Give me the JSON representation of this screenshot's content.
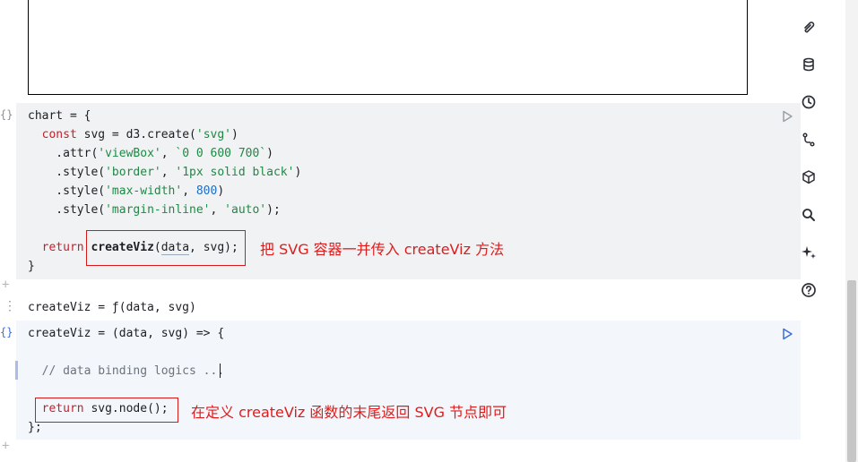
{
  "code_cell_1": {
    "lines": [
      {
        "p": [
          [
            "def",
            "chart"
          ],
          [
            "plain",
            " = {"
          ]
        ]
      },
      {
        "p": [
          [
            "plain",
            "  "
          ],
          [
            "kw",
            "const"
          ],
          [
            "plain",
            " svg = d3."
          ],
          [
            "def",
            "create"
          ],
          [
            "plain",
            "("
          ],
          [
            "str",
            "'svg'"
          ],
          [
            "plain",
            ")"
          ]
        ]
      },
      {
        "p": [
          [
            "plain",
            "    ."
          ],
          [
            "def",
            "attr"
          ],
          [
            "plain",
            "("
          ],
          [
            "str",
            "'viewBox'"
          ],
          [
            "plain",
            ", "
          ],
          [
            "str",
            "`0 0 600 700`"
          ],
          [
            "plain",
            ")"
          ]
        ]
      },
      {
        "p": [
          [
            "plain",
            "    ."
          ],
          [
            "def",
            "style"
          ],
          [
            "plain",
            "("
          ],
          [
            "str",
            "'border'"
          ],
          [
            "plain",
            ", "
          ],
          [
            "str",
            "'1px solid black'"
          ],
          [
            "plain",
            ")"
          ]
        ]
      },
      {
        "p": [
          [
            "plain",
            "    ."
          ],
          [
            "def",
            "style"
          ],
          [
            "plain",
            "("
          ],
          [
            "str",
            "'max-width'"
          ],
          [
            "plain",
            ", "
          ],
          [
            "num",
            "800"
          ],
          [
            "plain",
            ")"
          ]
        ]
      },
      {
        "p": [
          [
            "plain",
            "    ."
          ],
          [
            "def",
            "style"
          ],
          [
            "plain",
            "("
          ],
          [
            "str",
            "'margin-inline'"
          ],
          [
            "plain",
            ", "
          ],
          [
            "str",
            "'auto'"
          ],
          [
            "plain",
            ");"
          ]
        ]
      },
      {
        "p": []
      },
      {
        "p": [
          [
            "plain",
            "  "
          ],
          [
            "kw",
            "return"
          ],
          [
            "plain",
            " "
          ],
          [
            "bold",
            "createViz"
          ],
          [
            "plain",
            "("
          ],
          [
            "ul",
            "data"
          ],
          [
            "plain",
            ", svg);"
          ]
        ]
      },
      {
        "p": [
          [
            "plain",
            "}"
          ]
        ]
      }
    ]
  },
  "output_line": "createViz = ƒ(data, svg)",
  "code_cell_2": {
    "lines": [
      {
        "p": [
          [
            "def",
            "createViz"
          ],
          [
            "plain",
            " = (data, svg) => {"
          ]
        ]
      },
      {
        "p": []
      },
      {
        "p": [
          [
            "comment",
            "  // data binding logics ..."
          ]
        ]
      },
      {
        "p": []
      },
      {
        "p": [
          [
            "plain",
            "  "
          ],
          [
            "kw",
            "return"
          ],
          [
            "plain",
            " svg."
          ],
          [
            "def",
            "node"
          ],
          [
            "plain",
            "();"
          ]
        ]
      },
      {
        "p": [
          [
            "plain",
            "};"
          ]
        ]
      }
    ]
  },
  "annotations": {
    "first": "把 SVG 容器一并传入 createViz 方法",
    "second": "在定义 createViz 函数的末尾返回 SVG 节点即可"
  },
  "sidebar_icons": [
    "paperclip-icon",
    "database-icon",
    "history-icon",
    "git-branch-icon",
    "package-icon",
    "search-icon",
    "ai-sparkle-icon",
    "help-icon"
  ],
  "colors": {
    "keyword": "#c3212c",
    "string": "#1d8a45",
    "number": "#1d6ec5",
    "annotation": "#e01b1b"
  }
}
